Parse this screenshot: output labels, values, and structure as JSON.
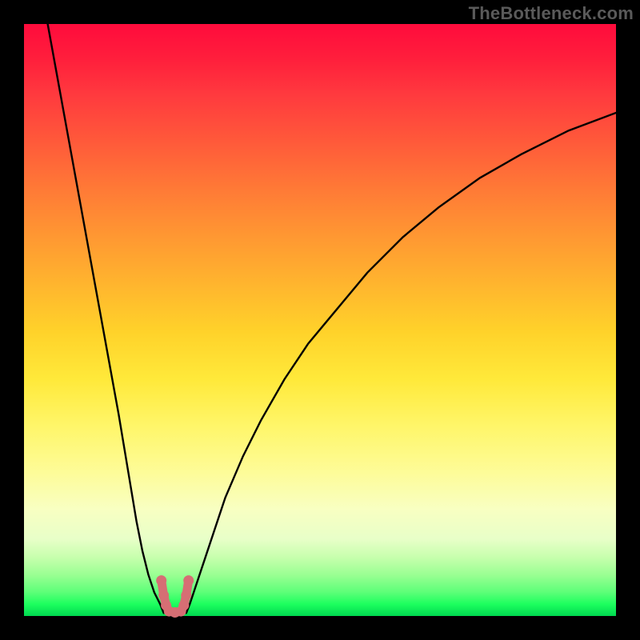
{
  "watermark": "TheBottleneck.com",
  "chart_data": {
    "type": "line",
    "title": "",
    "xlabel": "",
    "ylabel": "",
    "xlim": [
      0,
      100
    ],
    "ylim": [
      0,
      100
    ],
    "grid": false,
    "legend": false,
    "series": [
      {
        "name": "left-branch",
        "x": [
          4,
          6,
          8,
          10,
          12,
          14,
          16,
          18,
          19,
          20,
          21,
          22,
          23,
          23.6
        ],
        "y": [
          100,
          89,
          78,
          67,
          56,
          45,
          34,
          22,
          16,
          11,
          7,
          4,
          2,
          0.5
        ]
      },
      {
        "name": "right-branch",
        "x": [
          27.4,
          28,
          29,
          30,
          32,
          34,
          37,
          40,
          44,
          48,
          53,
          58,
          64,
          70,
          77,
          84,
          92,
          100
        ],
        "y": [
          0.5,
          2,
          5,
          8,
          14,
          20,
          27,
          33,
          40,
          46,
          52,
          58,
          64,
          69,
          74,
          78,
          82,
          85
        ]
      },
      {
        "name": "valley-marker",
        "x": [
          23.2,
          23.6,
          24.0,
          24.5,
          25.5,
          26.5,
          27.0,
          27.4,
          27.8
        ],
        "y": [
          6.0,
          3.5,
          1.8,
          0.8,
          0.6,
          0.8,
          1.8,
          3.5,
          6.0
        ]
      }
    ],
    "colors": {
      "curve": "#000000",
      "valley_marker": "#d66e74",
      "gradient_top": "#ff0b3c",
      "gradient_bottom": "#00d850"
    }
  }
}
